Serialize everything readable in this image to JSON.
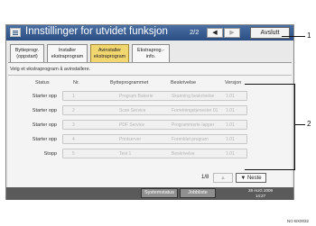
{
  "header": {
    "title": "Innstillinger for utvidet funksjon",
    "page": "2/2",
    "prev_icon": "◀",
    "next_icon": "▶",
    "exit_label": "Avslutt"
  },
  "tabs": [
    {
      "line1": "Bytteprogr.",
      "line2": "(oppstart)"
    },
    {
      "line1": "Installer",
      "line2": "ekstraprogram"
    },
    {
      "line1": "Avinstaller",
      "line2": "ekstraprogram"
    },
    {
      "line1": "Ekstraprog.-",
      "line2": "info."
    }
  ],
  "instruction": "Velg et ekstraprogram å avinstallere.",
  "columns": {
    "status": "Status",
    "nr": "Nr.",
    "name": "Bytteprogrammet",
    "desc": "Beskrivelse",
    "version": "Versjon"
  },
  "rows": [
    {
      "status": "Starter opp",
      "nr": "1",
      "name": "Program Bakerie",
      "desc": "Skanning beskrivelse",
      "version": "1.01"
    },
    {
      "status": "Starter opp",
      "nr": "2",
      "name": "Scan Service",
      "desc": "Forretningstjenester 01",
      "version": "1.01"
    },
    {
      "status": "Starter opp",
      "nr": "3",
      "name": "PDF Service",
      "desc": "Programmerte lapper",
      "version": "1.01"
    },
    {
      "status": "Starter opp",
      "nr": "4",
      "name": "Printserver",
      "desc": "Forenklet program",
      "version": "1.01"
    },
    {
      "status": "Stopp",
      "nr": "5",
      "name": "Test 1",
      "desc": "Beskrivelse",
      "version": "1.01"
    }
  ],
  "pager": {
    "indicator": "1/8",
    "up_icon": "▲",
    "down_label": "▼ Neste"
  },
  "footer": {
    "system_status": "Systemstatus",
    "job_list": "Jobbliste",
    "date": "28 AUG 2009",
    "time": "14:27"
  },
  "callouts": {
    "c1": "1",
    "c2": "2"
  },
  "figure_id": "NO BX0032"
}
